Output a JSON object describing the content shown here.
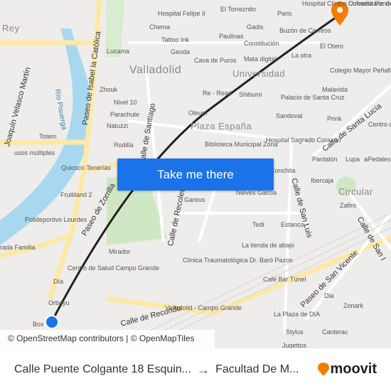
{
  "map": {
    "districts": [
      "Valladolid",
      "Universidad",
      "Plaza España",
      "Circular",
      "Rey"
    ],
    "streets": [
      "Paseo de Isabel la Católica",
      "Río Pisuerga",
      "Joaquín Velasco Martín",
      "Calle de Santiago",
      "Paseo de Zorrilla",
      "Calle de Recoletos",
      "Calle de Santa Lucía",
      "Calle de San Luis",
      "Paseo de San Vicente",
      "Calle de Recondo",
      "Calle de San I"
    ],
    "pois": [
      "Hospital Felipe II",
      "El Torreznito",
      "Paris",
      "Hospital Clínico Universitario de Valladolid",
      "Chema",
      "Gadis",
      "Buzón de Correos",
      "Cofradía Penitencial de la Sagrada Cena del Huerto y Pascual Bailón",
      "Tattoo Ink",
      "Paulinas",
      "Constitución",
      "Lucama",
      "Geoda",
      "Cava de Puros",
      "Mata digital",
      "La otra",
      "El Otero",
      "Colegio Mayor Peñafiel",
      "Zhouk",
      "Re - Read",
      "Shibumi",
      "Malavida",
      "Nivel 10",
      "Palacio de Santa Cruz",
      "Parachute",
      "Oleum",
      "Sandoval",
      "Natuzzi",
      "Prink",
      "Centro de Pilarica",
      "Totem",
      "Hospital Sagrado Corazón",
      "usos múltiples",
      "Rodilla",
      "Biblioteca Municipal Zona",
      "Pantalón",
      "Lupa",
      "aPedales",
      "Quiosco Tenerías",
      "Conchita",
      "Ibercaja",
      "Fruitiland 2",
      "Gareus",
      "Nieves García",
      "Zafiro",
      "Polideportivo Lourdes",
      "Tedi",
      "Estanco",
      "rada Familia",
      "Mirador",
      "La tienda de abajo",
      "Clínica Traumatológica Dr. Baró Pazos",
      "Centro de Salud Campo Grande",
      "Día",
      "Café Bar Túnel",
      "Orbayu",
      "Valladolid - Campo Grande",
      "Dia",
      "Zonark",
      "Box",
      "La Plaza de DIA",
      "Stylus",
      "Canterac",
      "Jugettos"
    ],
    "button": "Take me there",
    "attribution": "© OpenStreetMap contributors | © OpenMapTiles",
    "colors": {
      "route": "#222222",
      "origin": "#1a73e8",
      "destination": "#f57c00",
      "button": "#1a73e8",
      "river": "#a8d8f0",
      "park": "#cfe8c3"
    }
  },
  "footer": {
    "origin": "Calle Puente Colgante 18 Esquin...",
    "arrow": "→",
    "destination": "Facultad De M...",
    "brand": "moovit"
  }
}
